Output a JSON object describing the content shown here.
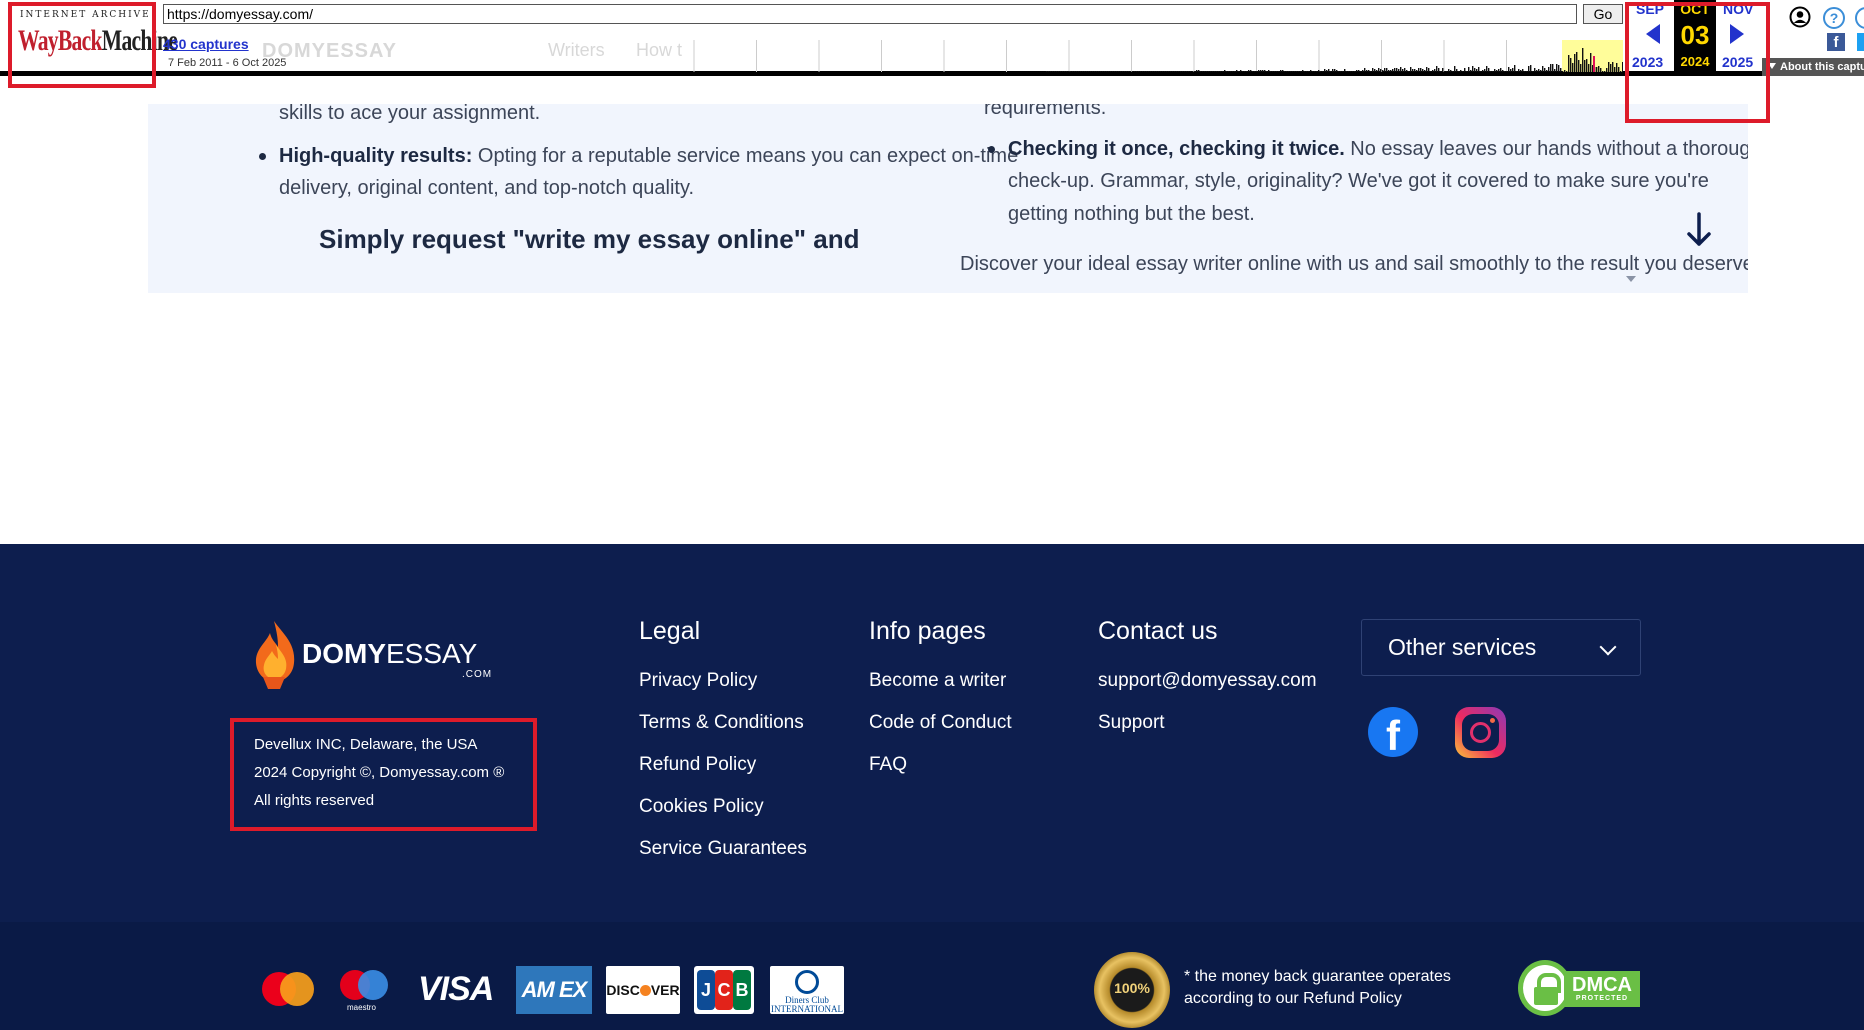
{
  "wayback": {
    "logo_top": "INTERNET ARCHIVE",
    "logo_way": "WayBack",
    "logo_machine": "Machine",
    "url": "https://domyessay.com/",
    "go_label": "Go",
    "captures": "430 captures",
    "range": "7 Feb 2011 - 6 Oct 2025",
    "ghost_logo": "DOMYESSAY",
    "ghost_nav": [
      "Writers",
      "How t"
    ],
    "prev_month": "SEP",
    "cur_month": "OCT",
    "next_month": "NOV",
    "cur_day": "03",
    "prev_year": "2023",
    "cur_year": "2024",
    "next_year": "2025",
    "help": "?",
    "fb": "f",
    "about": "About this captu"
  },
  "article": {
    "left": {
      "top_line": "skills to ace your assignment.",
      "item_bold": "High-quality results:",
      "item_text": " Opting for a reputable service means you can expect on-time delivery, original content, and top-notch quality.",
      "cut_heading": "Simply request \"write my essay online\" and"
    },
    "right": {
      "top_line": "requirements.",
      "item_bold": "Checking it once, checking it twice.",
      "item_text": " No essay leaves our hands without a thorough check-up. Grammar, style, originality? We've got it covered to make sure you're getting nothing but the best.",
      "paragraph": "Discover your ideal essay writer online with us and sail smoothly to the result you deserve!"
    }
  },
  "footer": {
    "brand_bold": "DOMY",
    "brand_rest": "ESSAY",
    "brand_com": ".COM",
    "company_lines": [
      "Devellux INC, Delaware, the USA",
      "2024 Copyright ©, Domyessay.com ®",
      "All rights reserved"
    ],
    "legal": {
      "title": "Legal",
      "links": [
        "Privacy Policy",
        "Terms & Conditions",
        "Refund Policy",
        "Cookies Policy",
        "Service Guarantees"
      ]
    },
    "info": {
      "title": "Info pages",
      "links": [
        "Become a writer",
        "Code of Conduct",
        "FAQ"
      ]
    },
    "contact": {
      "title": "Contact us",
      "links": [
        "support@domyessay.com",
        "Support"
      ]
    },
    "services_label": "Other services",
    "payments": {
      "maestro": "maestro",
      "visa": "VISA",
      "amex": "AM EX",
      "discover_a": "DISC",
      "discover_b": "VER",
      "jcb": [
        "J",
        "C",
        "B"
      ],
      "diners": "Diners Club INTERNATIONAL"
    },
    "money_badge": "100%",
    "money_note_lines": [
      "* the money back guarantee operates",
      "according to our Refund Policy"
    ],
    "dmca": "DMCA",
    "dmca_sub": "PROTECTED"
  },
  "colors": {
    "footer_bg": "#0d1e4e",
    "article_bg": "#f1f5fd",
    "highlight": "#dd1b2a",
    "wayback_blue": "#2233cc",
    "wayback_yellow": "#ffd800"
  }
}
